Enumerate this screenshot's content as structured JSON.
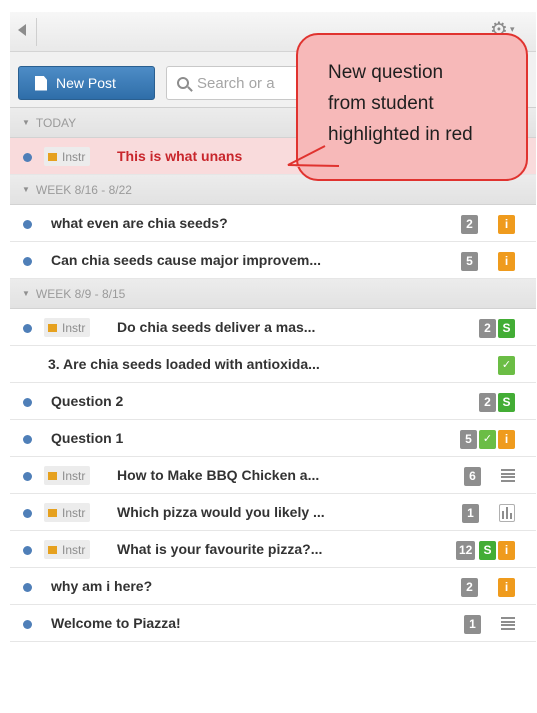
{
  "toolbar": {
    "new_post_label": "New Post",
    "search_placeholder": "Search or a"
  },
  "groups": [
    {
      "header": "TODAY",
      "posts": [
        {
          "title": "This is what unans",
          "instr": "Instr",
          "highlight": true,
          "dot": true,
          "badges": []
        }
      ]
    },
    {
      "header": "WEEK 8/16 - 8/22",
      "posts": [
        {
          "title": "what even are chia seeds?",
          "dot": true,
          "badges": [
            {
              "type": "count",
              "text": "2"
            },
            {
              "type": "i",
              "text": "i"
            }
          ]
        },
        {
          "title": "Can chia seeds cause major improvem...",
          "dot": true,
          "badges": [
            {
              "type": "count",
              "text": "5"
            },
            {
              "type": "i",
              "text": "i"
            }
          ]
        }
      ]
    },
    {
      "header": "WEEK 8/9 - 8/15",
      "posts": [
        {
          "title": "Do chia seeds deliver a mas...",
          "instr": "Instr",
          "dot": true,
          "badges": [
            {
              "type": "count",
              "text": "2"
            },
            {
              "type": "s",
              "text": "S"
            }
          ]
        },
        {
          "title": "3. Are chia seeds loaded with antioxida...",
          "dot": false,
          "badges": [
            {
              "type": "check",
              "text": "✓"
            }
          ]
        },
        {
          "title": "Question 2",
          "dot": true,
          "badges": [
            {
              "type": "count",
              "text": "2"
            },
            {
              "type": "s",
              "text": "S"
            }
          ]
        },
        {
          "title": "Question 1",
          "dot": true,
          "badges": [
            {
              "type": "count",
              "text": "5"
            },
            {
              "type": "check",
              "text": "✓"
            },
            {
              "type": "i",
              "text": "i"
            }
          ]
        },
        {
          "title": "How to Make BBQ Chicken a...",
          "instr": "Instr",
          "dot": true,
          "badges": [
            {
              "type": "count",
              "text": "6"
            },
            {
              "type": "note",
              "text": ""
            }
          ]
        },
        {
          "title": "Which pizza would you likely ...",
          "instr": "Instr",
          "dot": true,
          "badges": [
            {
              "type": "count",
              "text": "1"
            },
            {
              "type": "poll",
              "text": ""
            }
          ]
        },
        {
          "title": "What is your favourite pizza?...",
          "instr": "Instr",
          "dot": true,
          "badges": [
            {
              "type": "count",
              "text": "12"
            },
            {
              "type": "s",
              "text": "S"
            },
            {
              "type": "i",
              "text": "i"
            }
          ]
        },
        {
          "title": "why am i here?",
          "dot": true,
          "badges": [
            {
              "type": "count",
              "text": "2"
            },
            {
              "type": "i",
              "text": "i"
            }
          ]
        },
        {
          "title": "Welcome to Piazza!",
          "dot": true,
          "badges": [
            {
              "type": "count",
              "text": "1"
            },
            {
              "type": "note",
              "text": ""
            }
          ]
        }
      ]
    }
  ],
  "callout": {
    "lines": [
      "New question",
      "from student",
      "highlighted in red"
    ]
  },
  "colors": {
    "accent_blue": "#2f6ea9",
    "unread_dot": "#4f7fb8",
    "highlight_bg": "#f9dbdc",
    "highlight_text": "#c8262c",
    "callout_fill": "#f7b9b9",
    "callout_border": "#e0332f"
  },
  "icons": {
    "collapse": "left-triangle-icon",
    "settings": "gear-icon",
    "search": "search-icon",
    "new_post": "document-icon"
  }
}
